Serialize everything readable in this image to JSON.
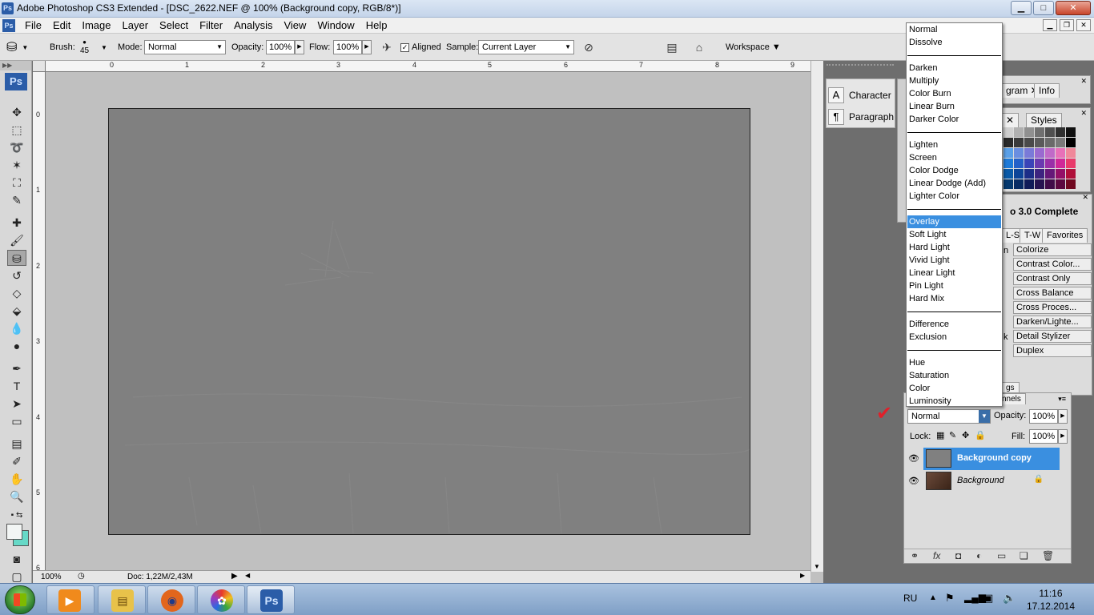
{
  "window": {
    "title": "Adobe Photoshop CS3 Extended - [DSC_2622.NEF @ 100% (Background copy, RGB/8*)]",
    "app_badge": "Ps",
    "controls": {
      "minimize": "▁",
      "maximize": "□",
      "close": "✕"
    }
  },
  "menubar": {
    "items": [
      "File",
      "Edit",
      "Image",
      "Layer",
      "Select",
      "Filter",
      "Analysis",
      "View",
      "Window",
      "Help"
    ],
    "doc_controls": {
      "minimize": "▁",
      "restore": "❐",
      "close": "✕"
    }
  },
  "options": {
    "brush_label": "Brush:",
    "brush_size": "45",
    "mode_label": "Mode:",
    "mode_value": "Normal",
    "opacity_label": "Opacity:",
    "opacity_value": "100%",
    "flow_label": "Flow:",
    "flow_value": "100%",
    "aligned_label": "Aligned",
    "aligned_checked": "✓",
    "sample_label": "Sample:",
    "sample_value": "Current Layer",
    "workspace_label": "Workspace ▼"
  },
  "tools": {
    "logo": "Ps"
  },
  "rulers": {
    "top": [
      "0",
      "1",
      "2",
      "3",
      "4",
      "5",
      "6",
      "7",
      "8",
      "9"
    ],
    "left": [
      "0",
      "1",
      "2",
      "3",
      "4",
      "5",
      "6"
    ]
  },
  "status": {
    "zoom": "100%",
    "doc": "Doc: 1,22M/2,43M"
  },
  "char_panel": {
    "character": "Character",
    "paragraph": "Paragraph"
  },
  "history_panel": {
    "tab_histogram": "gram",
    "tab_info": "Info"
  },
  "swatch_panel": {
    "tab_styles": "Styles"
  },
  "actions_panel": {
    "title": "o 3.0 Complete",
    "tabs": [
      "L-S",
      "T-W",
      "Favorites"
    ],
    "buttons": [
      "Colorize",
      "Contrast Color...",
      "Contrast Only",
      "Cross Balance",
      "Cross Proces...",
      "Darken/Lighte...",
      "Detail Stylizer",
      "Duplex"
    ],
    "side_marks": [
      "n",
      "",
      "",
      "",
      "",
      "",
      "k",
      ""
    ],
    "partial_tabs": [
      "gs",
      "nnels"
    ]
  },
  "layers_panel": {
    "blend_value": "Normal",
    "opacity_label": "Opacity:",
    "opacity_value": "100%",
    "lock_label": "Lock:",
    "fill_label": "Fill:",
    "fill_value": "100%",
    "layers": [
      {
        "name": "Background copy",
        "selected": true
      },
      {
        "name": "Background",
        "selected": false,
        "locked": true
      }
    ]
  },
  "blend_menu": {
    "groups": [
      [
        "Normal",
        "Dissolve"
      ],
      [
        "Darken",
        "Multiply",
        "Color Burn",
        "Linear Burn",
        "Darker Color"
      ],
      [
        "Lighten",
        "Screen",
        "Color Dodge",
        "Linear Dodge (Add)",
        "Lighter Color"
      ],
      [
        "Overlay",
        "Soft Light",
        "Hard Light",
        "Vivid Light",
        "Linear Light",
        "Pin Light",
        "Hard Mix"
      ],
      [
        "Difference",
        "Exclusion"
      ],
      [
        "Hue",
        "Saturation",
        "Color",
        "Luminosity"
      ]
    ],
    "selected": "Overlay"
  },
  "taskbar": {
    "apps": [
      {
        "name": "media-player",
        "icon": "▶",
        "color": "#f08a1c"
      },
      {
        "name": "explorer",
        "icon": "▤",
        "color": "#e8c24a"
      },
      {
        "name": "firefox",
        "icon": "◉",
        "color": "#e2661c"
      },
      {
        "name": "picasa",
        "icon": "✿",
        "color": "#7b49c2"
      },
      {
        "name": "photoshop",
        "icon": "Ps",
        "color": "#2b5da8"
      }
    ],
    "lang": "RU",
    "time": "11:16",
    "date": "17.12.2014"
  },
  "colors": {
    "selection": "#3a8fe0",
    "canvas": "#808080",
    "background_swatch": "#66d9c7"
  }
}
